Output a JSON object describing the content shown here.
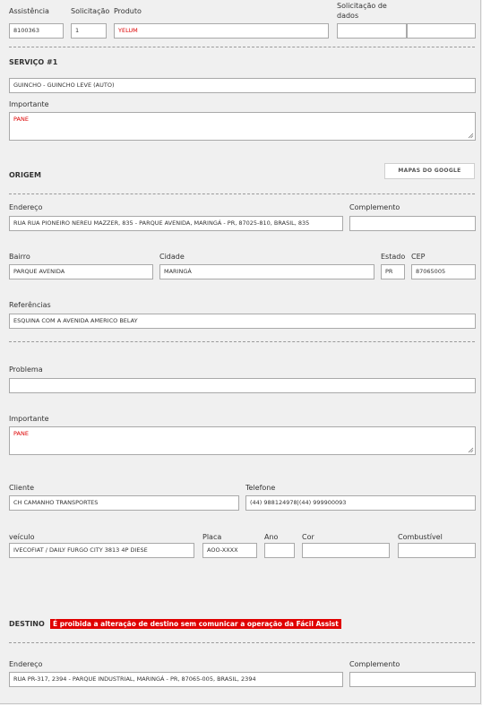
{
  "header": {
    "assistencia": {
      "label": "Assistência",
      "value": "8100363"
    },
    "solicitacao": {
      "label": "Solicitação",
      "value": "1"
    },
    "produto": {
      "label": "Produto",
      "value": "YELUM"
    },
    "solicitacao_dados": {
      "label_line1": "Solicitação de",
      "label_line2": "dados",
      "value1": "",
      "value2": ""
    }
  },
  "servico": {
    "title": "SERVIÇO #1",
    "service_value": "GUINCHO - GUINCHO LEVE (AUTO)",
    "importante_label": "Importante",
    "importante_value": "PANE"
  },
  "origem": {
    "title": "ORIGEM",
    "maps_button": "MAPAS DO GOOGLE",
    "endereco_label": "Endereço",
    "endereco_value": "RUA RUA PIONEIRO NEREU MAZZER, 835 - PARQUE AVENIDA, MARINGÁ - PR, 87025-810, BRASIL, 835",
    "complemento_label": "Complemento",
    "complemento_value": "",
    "bairro_label": "Bairro",
    "bairro_value": "PARQUE AVENIDA",
    "cidade_label": "Cidade",
    "cidade_value": "MARINGÁ",
    "estado_label": "Estado",
    "estado_value": "PR",
    "cep_label": "CEP",
    "cep_value": "87065005",
    "referencias_label": "Referências",
    "referencias_value": "ESQUINA COM A AVENIDA AMERICO BELAY"
  },
  "problema": {
    "problema_label": "Problema",
    "problema_value": "",
    "importante_label": "Importante",
    "importante_value": "PANE",
    "cliente_label": "Cliente",
    "cliente_value": "CH CAMANHO TRANSPORTES",
    "telefone_label": "Telefone",
    "telefone_value": "(44) 988124978|(44) 999900093",
    "veiculo_label": "veículo",
    "veiculo_value": "IVECOFIAT / DAILY FURGO CITY 3813 4P DIESE",
    "placa_label": "Placa",
    "placa_value": "AOO-XXXX",
    "ano_label": "Ano",
    "ano_value": "",
    "cor_label": "Cor",
    "cor_value": "",
    "combustivel_label": "Combustível",
    "combustivel_value": ""
  },
  "destino": {
    "title": "DESTINO",
    "warning": "É proibida a alteração de destino sem comunicar a operação da Fácil Assist",
    "endereco_label": "Endereço",
    "endereco_value": "RUA PR-317, 2394 - PARQUE INDUSTRIAL, MARINGÁ - PR, 87065-005, BRASIL, 2394",
    "complemento_label": "Complemento",
    "complemento_value": ""
  },
  "colors": {
    "warning_bg": "#e00000",
    "highlight_text": "#dd0000"
  }
}
